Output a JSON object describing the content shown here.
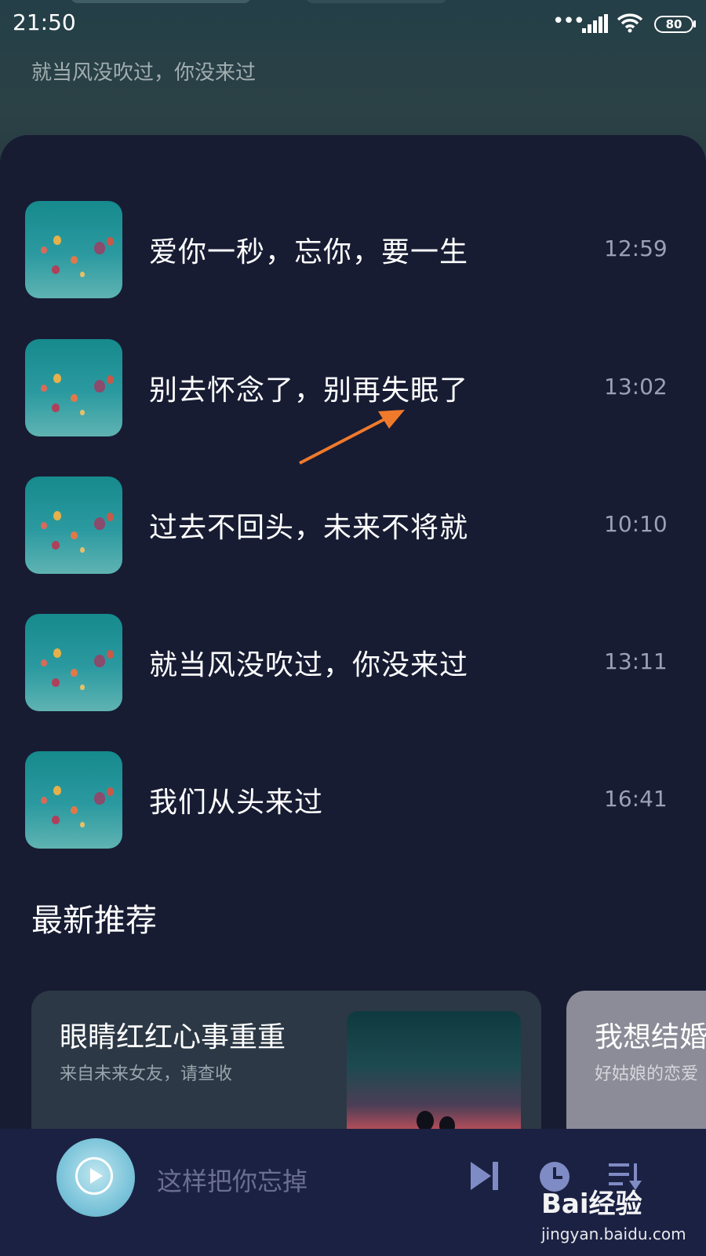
{
  "status_bar": {
    "time": "21:50",
    "battery": "80"
  },
  "header": {
    "subtitle": "就当风没吹过，你没来过"
  },
  "songs": [
    {
      "title": "爱你一秒，忘你，要一生",
      "time": "12:59"
    },
    {
      "title": "别去怀念了，别再失眠了",
      "time": "13:02"
    },
    {
      "title": "过去不回头，未来不将就",
      "time": "10:10"
    },
    {
      "title": "就当风没吹过，你没来过",
      "time": "13:11"
    },
    {
      "title": "我们从头来过",
      "time": "16:41"
    }
  ],
  "recommend": {
    "section_title": "最新推荐",
    "cards": [
      {
        "title": "眼睛红红心事重重",
        "subtitle": "来自未来女友，请查收"
      },
      {
        "title": "我想结婚",
        "subtitle": "好姑娘的恋爱"
      }
    ]
  },
  "player": {
    "now_playing": "这样把你忘掉"
  },
  "watermark": {
    "brand": "Bai经验",
    "url": "jingyan.baidu.com"
  },
  "colors": {
    "background": "#171c33",
    "arrow": "#f07a2c",
    "player_bar": "#1b2142"
  }
}
